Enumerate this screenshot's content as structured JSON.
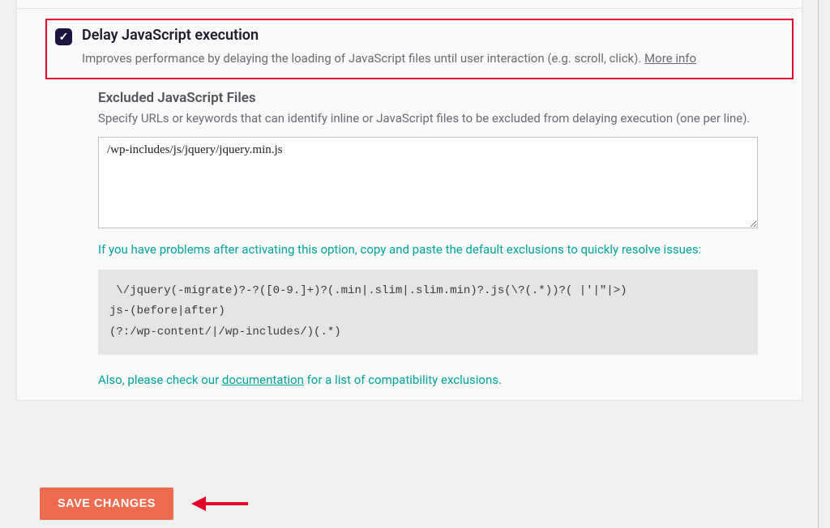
{
  "option": {
    "title": "Delay JavaScript execution",
    "description_text": "Improves performance by delaying the loading of JavaScript files until user interaction (e.g. scroll, click). ",
    "more_info_label": "More info",
    "checked": true
  },
  "excluded": {
    "title": "Excluded JavaScript Files",
    "description": "Specify URLs or keywords that can identify inline or JavaScript files to be excluded from delaying execution (one per line).",
    "textarea_value": "/wp-includes/js/jquery/jquery.min.js"
  },
  "tips": {
    "problem_hint": "If you have problems after activating this option, copy and paste the default exclusions to quickly resolve issues:",
    "code": " \\/jquery(-migrate)?-?([0-9.]+)?(.min|.slim|.slim.min)?.js(\\?(.*))?( |'|\"|>)\njs-(before|after)\n(?:/wp-content/|/wp-includes/)(.*)",
    "doc_prefix": "Also, please check our ",
    "doc_link_label": "documentation",
    "doc_suffix": " for a list of compatibility exclusions."
  },
  "actions": {
    "save_label": "SAVE CHANGES"
  }
}
